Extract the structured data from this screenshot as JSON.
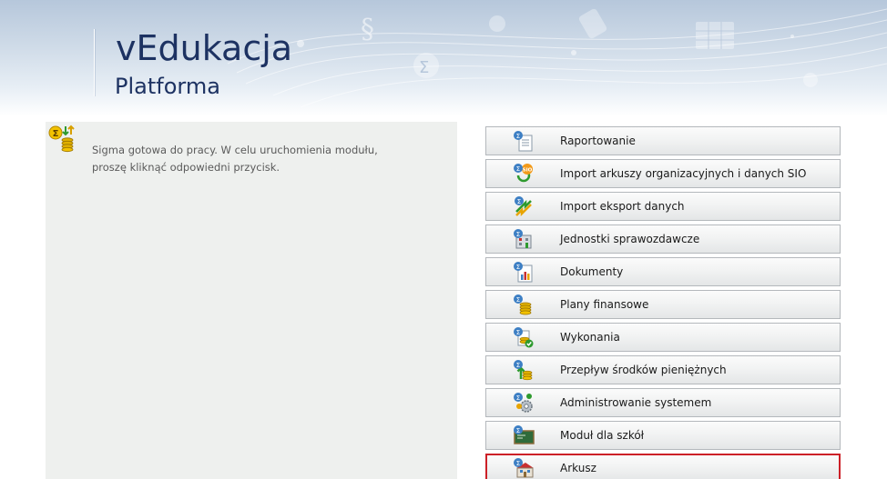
{
  "header": {
    "title": "vEdukacja",
    "subtitle": "Platforma"
  },
  "info_panel": {
    "icon": "sigma-coins-icon",
    "message": "Sigma gotowa do pracy. W celu uruchomienia modułu, proszę kliknąć odpowiedni przycisk."
  },
  "modules": [
    {
      "label": "Raportowanie",
      "icon": "report-document-icon"
    },
    {
      "label": "Import arkuszy organizacyjnych i danych SIO",
      "icon": "sio-import-icon"
    },
    {
      "label": "Import eksport danych",
      "icon": "import-export-arrows-icon"
    },
    {
      "label": "Jednostki sprawozdawcze",
      "icon": "reporting-units-icon"
    },
    {
      "label": "Dokumenty",
      "icon": "documents-chart-icon"
    },
    {
      "label": "Plany finansowe",
      "icon": "financial-plans-coins-icon"
    },
    {
      "label": "Wykonania",
      "icon": "executions-check-icon"
    },
    {
      "label": "Przepływ środków pieniężnych",
      "icon": "cash-flow-arrow-icon"
    },
    {
      "label": "Administrowanie systemem",
      "icon": "system-admin-gears-icon"
    },
    {
      "label": "Moduł dla szkół",
      "icon": "school-blackboard-icon"
    },
    {
      "label": "Arkusz",
      "icon": "school-building-icon",
      "selected": true
    }
  ],
  "colors": {
    "title": "#1d3262",
    "selected_border": "#cc2027",
    "panel_bg": "#eef0ee",
    "sigma_badge": "#3d7fc4"
  }
}
